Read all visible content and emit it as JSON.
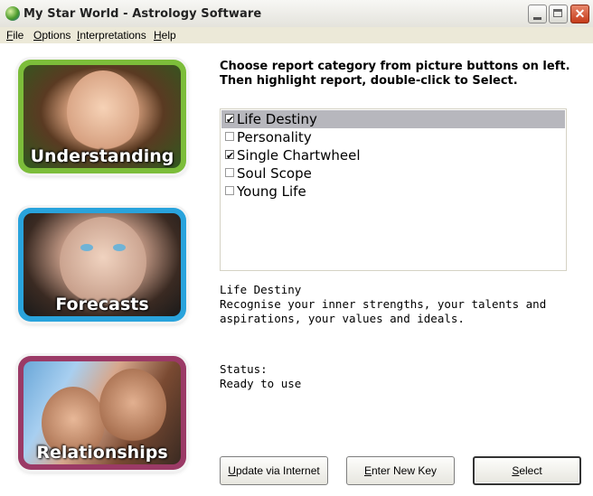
{
  "window": {
    "title": "My Star World - Astrology Software",
    "close_glyph": "✕"
  },
  "menu": [
    {
      "key": "F",
      "rest": "ile"
    },
    {
      "key": "O",
      "rest": "ptions"
    },
    {
      "key": "I",
      "rest": "nterpretations"
    },
    {
      "key": "H",
      "rest": "elp"
    }
  ],
  "categories": [
    {
      "label": "Understanding",
      "color": "#7cbd3a"
    },
    {
      "label": "Forecasts",
      "color": "#29a3dc"
    },
    {
      "label": "Relationships",
      "color": "#9b3a66"
    }
  ],
  "instructions": {
    "line1": "Choose report category from picture buttons on left.",
    "line2": "Then highlight report, double-click to Select."
  },
  "reports": [
    {
      "name": "Life Destiny",
      "checked": true,
      "selected": true
    },
    {
      "name": "Personality",
      "checked": false,
      "selected": false
    },
    {
      "name": "Single Chartwheel",
      "checked": true,
      "selected": false
    },
    {
      "name": "Soul Scope",
      "checked": false,
      "selected": false
    },
    {
      "name": "Young Life",
      "checked": false,
      "selected": false
    }
  ],
  "description": {
    "title": "Life Destiny",
    "text1": "Recognise your inner strengths, your talents and",
    "text2": "aspirations, your values and ideals."
  },
  "status": {
    "label": "Status:",
    "value": "Ready to use"
  },
  "buttons": {
    "update": {
      "key": "U",
      "rest": "pdate via Internet"
    },
    "key": {
      "key": "E",
      "rest": "nter New Key"
    },
    "select": {
      "key": "S",
      "rest": "elect"
    }
  }
}
